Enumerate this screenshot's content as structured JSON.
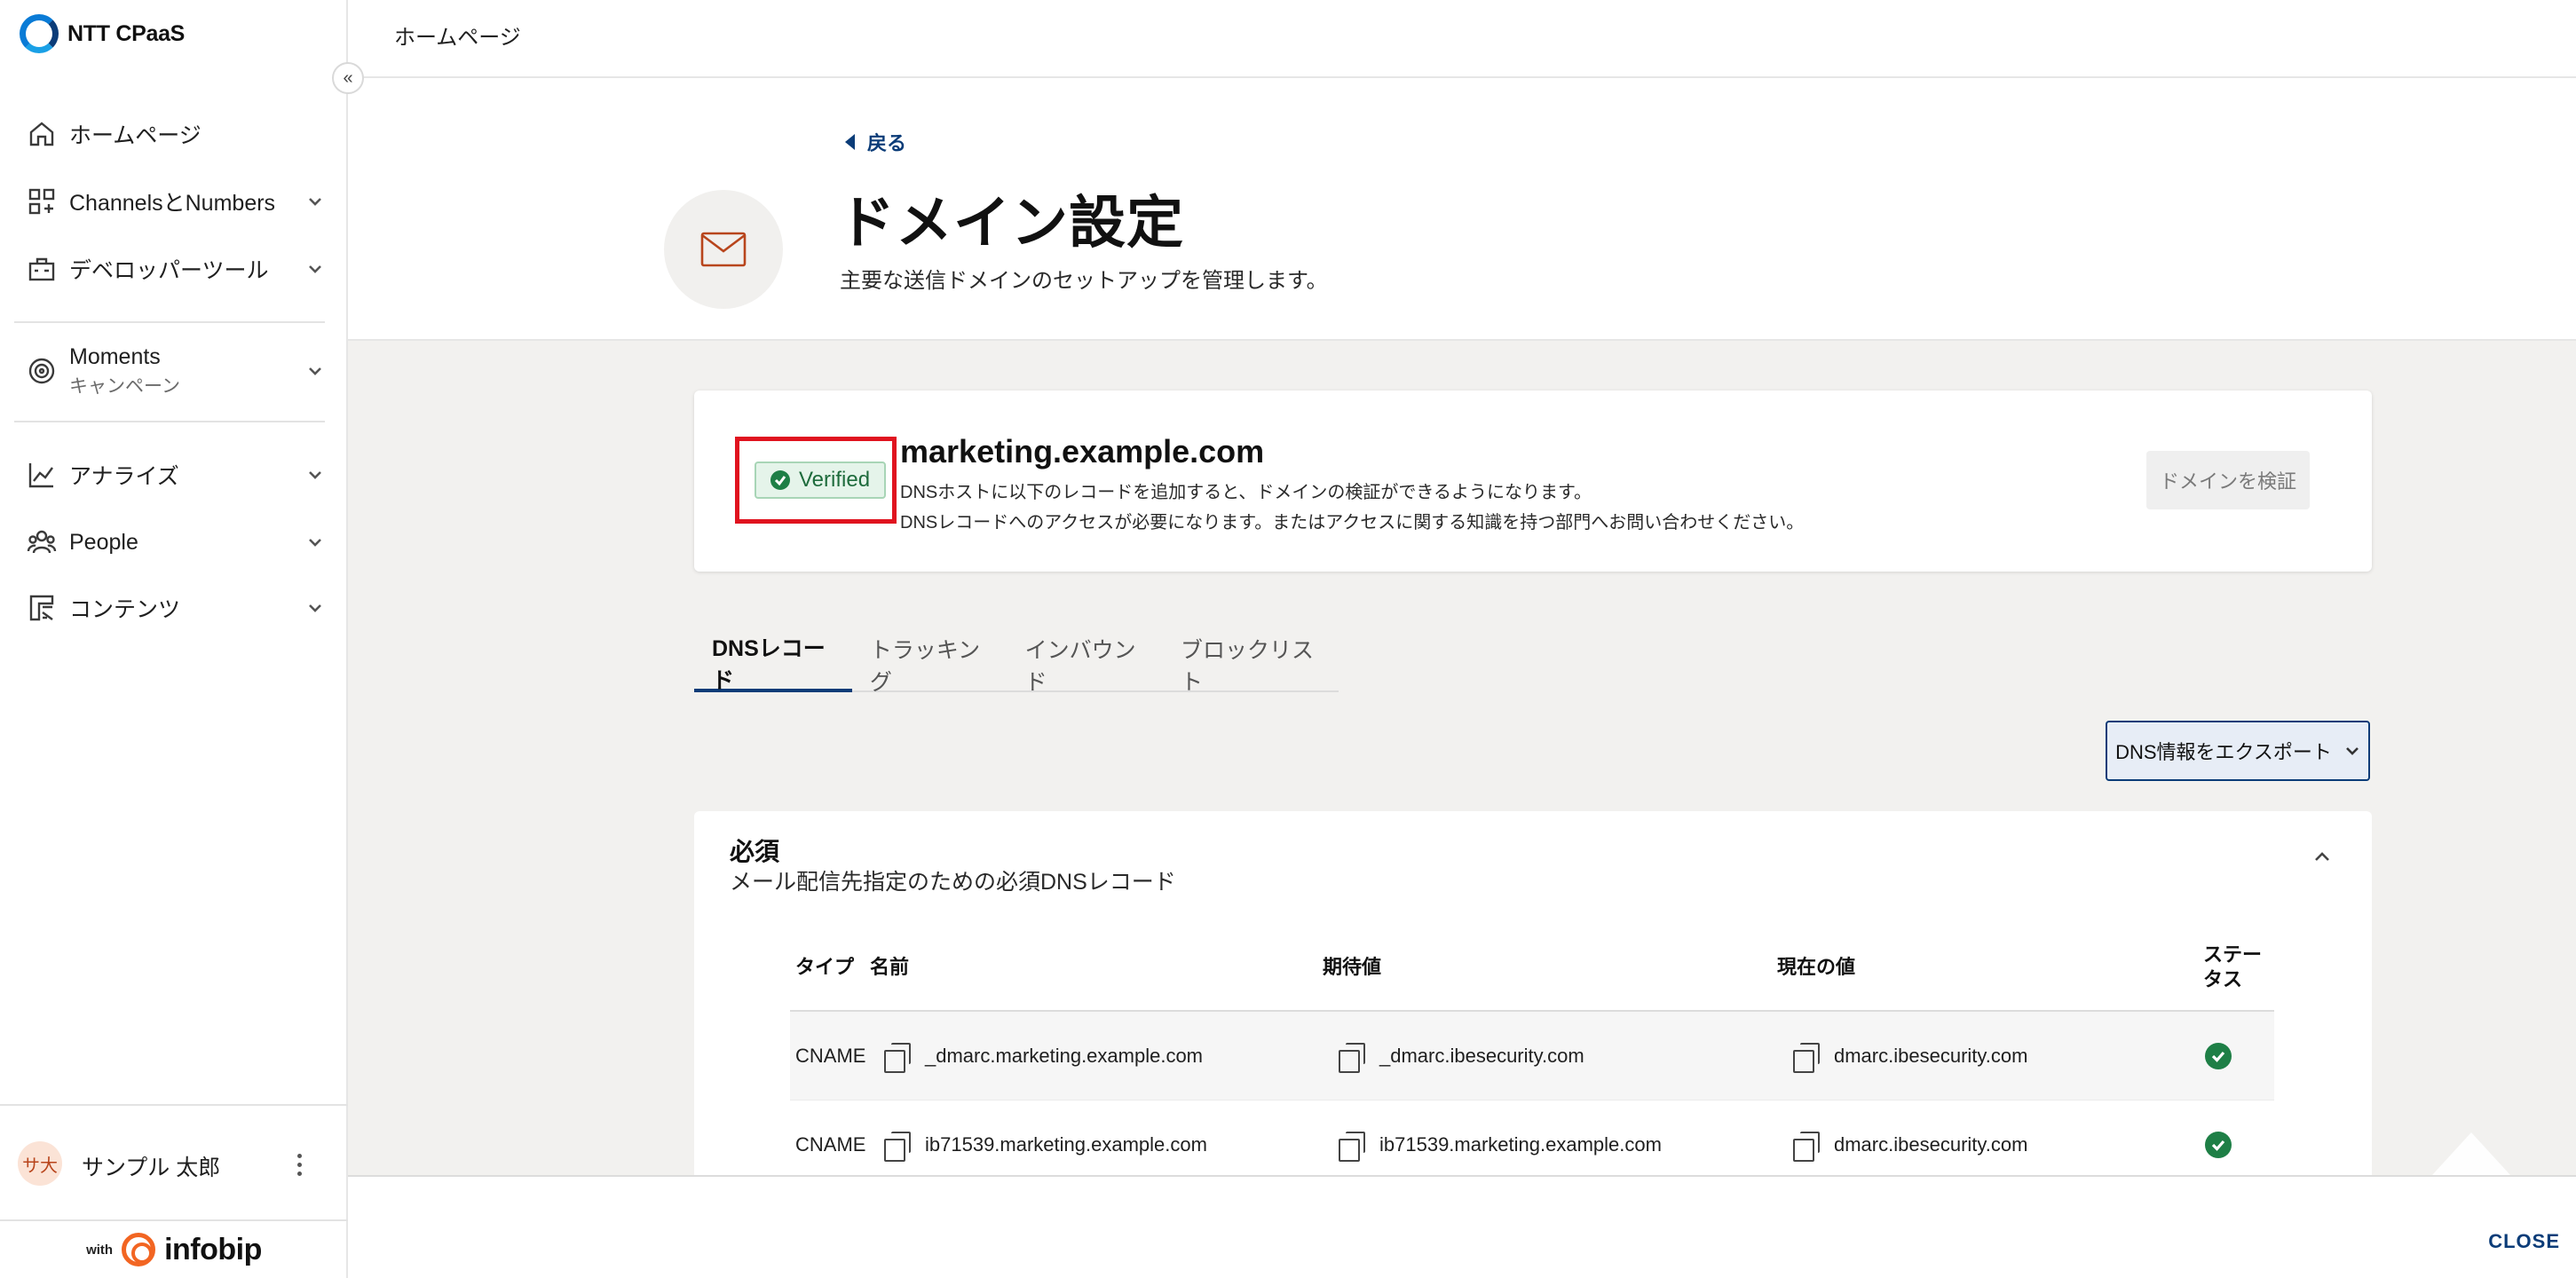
{
  "brand": {
    "name": "NTT CPaaS",
    "powered_with": "with",
    "powered_by": "infobip"
  },
  "sidebar": {
    "collapse_glyph": "«",
    "items": [
      {
        "label": "ホームページ",
        "icon": "home-icon"
      },
      {
        "label": "ChannelsとNumbers",
        "icon": "grid-icon"
      },
      {
        "label": "デベロッパーツール",
        "icon": "toolbox-icon"
      },
      {
        "label": "Moments",
        "sub": "キャンペーン",
        "icon": "target-icon"
      },
      {
        "label": "アナライズ",
        "icon": "chart-icon"
      },
      {
        "label": "People",
        "icon": "people-icon"
      },
      {
        "label": "コンテンツ",
        "icon": "content-icon"
      }
    ]
  },
  "user": {
    "initials": "サ大",
    "name": "サンプル 太郎"
  },
  "topbar": {
    "title": "ホームページ"
  },
  "header": {
    "back_label": "戻る",
    "title": "ドメイン設定",
    "subtitle": "主要な送信ドメインのセットアップを管理します。"
  },
  "domain": {
    "status": "Verified",
    "name": "marketing.example.com",
    "desc_line1": "DNSホストに以下のレコードを追加すると、ドメインの検証ができるようになります。",
    "desc_line2": "DNSレコードへのアクセスが必要になります。またはアクセスに関する知識を持つ部門へお問い合わせください。",
    "verify_button": "ドメインを検証"
  },
  "tabs": [
    "DNSレコード",
    "トラッキング",
    "インバウンド",
    "ブロックリスト"
  ],
  "export_button": "DNS情報をエクスポート",
  "required": {
    "title": "必須",
    "subtitle": "メール配信先指定のための必須DNSレコード",
    "columns": {
      "type": "タイプ",
      "name": "名前",
      "expected": "期待値",
      "current": "現在の値",
      "status_1": "ステー",
      "status_2": "タス"
    },
    "rows": [
      {
        "type": "CNAME",
        "name": "_dmarc.marketing.example.com",
        "expected": "_dmarc.ibesecurity.com",
        "current": "dmarc.ibesecurity.com",
        "status": "ok"
      },
      {
        "type": "CNAME",
        "name": "ib71539.marketing.example.com",
        "expected": "ib71539.marketing.example.com",
        "current": "dmarc.ibesecurity.com",
        "status": "ok"
      }
    ]
  },
  "footer": {
    "close_label": "CLOSE"
  },
  "colors": {
    "accent": "#0b3c78",
    "success": "#1e7f46",
    "highlight": "#e0131f",
    "brand_orange": "#f26522"
  }
}
